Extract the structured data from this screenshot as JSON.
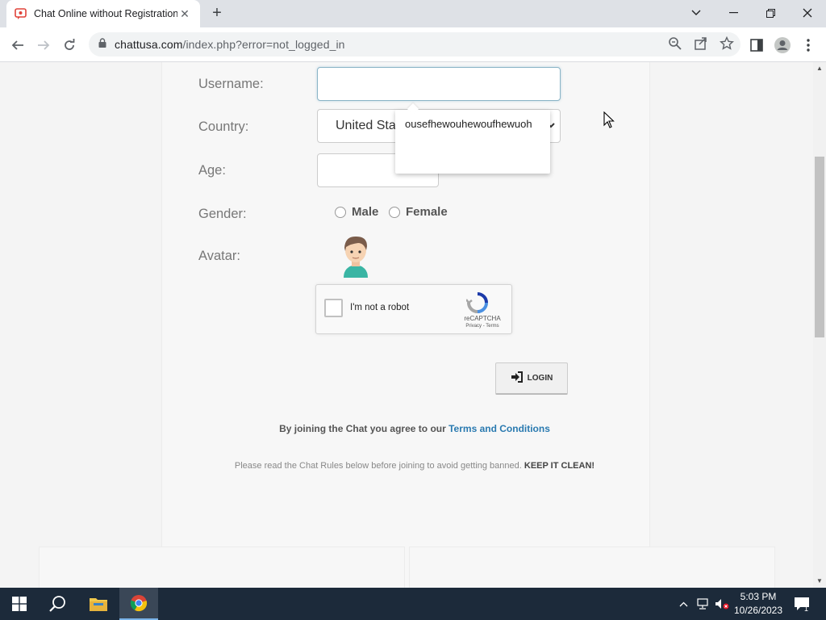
{
  "browser": {
    "tab_title": "Chat Online without Registration",
    "tab_close": "✕",
    "new_tab": "+",
    "url_host": "chattusa.com",
    "url_path": "/index.php?error=not_logged_in"
  },
  "form": {
    "username_label": "Username:",
    "country_label": "Country:",
    "country_value": "United Sta",
    "age_label": "Age:",
    "gender_label": "Gender:",
    "gender_male": "Male",
    "gender_female": "Female",
    "avatar_label": "Avatar:",
    "captcha_text": "I'm not a robot",
    "captcha_brand": "reCAPTCHA",
    "captcha_links": "Privacy - Terms",
    "login_label": "LOGIN",
    "agree_text": "By joining the Chat you agree to our ",
    "agree_link": "Terms and Conditions",
    "rules_text": "Please read the Chat Rules below before joining to avoid getting banned. ",
    "rules_emphasis": "KEEP IT CLEAN!"
  },
  "autocomplete": {
    "items": [
      "ousefhewouhewoufhewuoh"
    ]
  },
  "taskbar": {
    "time": "5:03 PM",
    "date": "10/26/2023",
    "notification_count": "1"
  },
  "icons": {
    "favicon": "chat-favicon-icon",
    "lock": "lock-icon",
    "login": "sign-in-icon"
  },
  "colors": {
    "link": "#2a7ab0",
    "taskbar": "#1c2a3a",
    "input_focus": "#8ab4c6"
  }
}
